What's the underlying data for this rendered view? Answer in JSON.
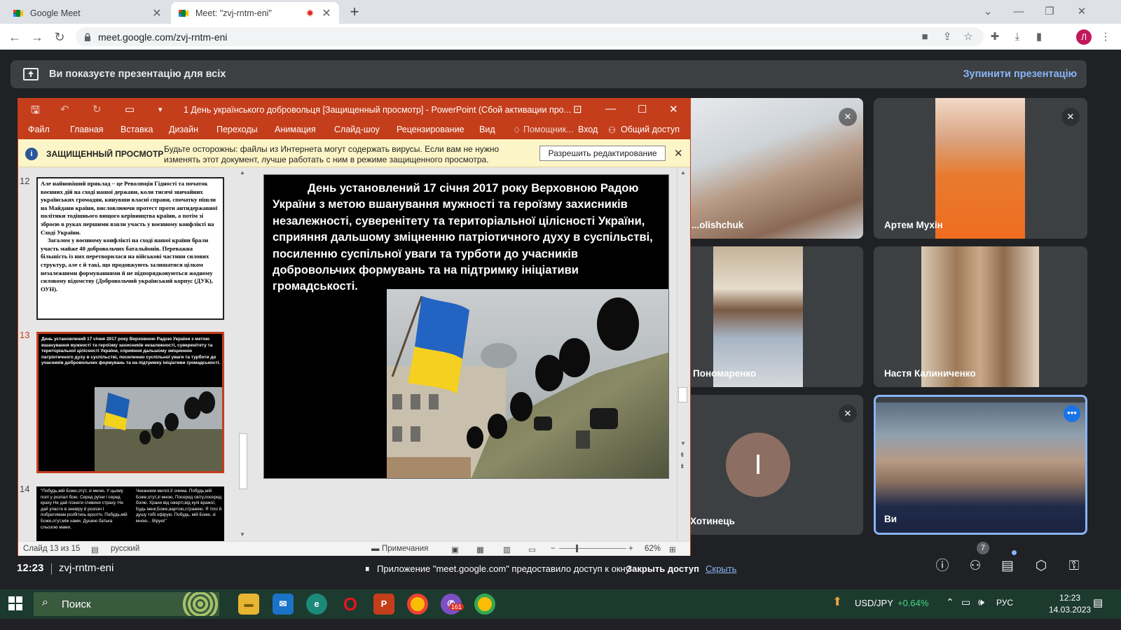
{
  "browser": {
    "tabs": [
      {
        "title": "Google Meet"
      },
      {
        "title": "Meet: \"zvj-rntm-eni\""
      }
    ],
    "url": "meet.google.com/zvj-rntm-eni",
    "profile_initial": "Л"
  },
  "meet": {
    "banner_text": "Ви показуєте презентацію для всіх",
    "stop_label": "Зупинити презентацію",
    "participants": [
      {
        "name": "...olishchuk",
        "muted": true
      },
      {
        "name": "Артем Мухін",
        "muted": true
      },
      {
        "name": "Пономаренко",
        "muted": false
      },
      {
        "name": "Настя Калиниченко",
        "muted": false
      },
      {
        "name": "Хотинець",
        "initial": "І",
        "muted": true
      },
      {
        "name": "Ви",
        "muted": false
      }
    ],
    "time": "12:23",
    "meeting_code": "zvj-rntm-eni",
    "participant_count": "7",
    "share_notice": "Приложение \"meet.google.com\" предоставило доступ к окну.",
    "close_access": "Закрыть доступ",
    "hide": "Скрыть"
  },
  "ppt": {
    "title": "1 День українського добровольця [Защищенный просмотр] - PowerPoint (Сбой активации про...",
    "menu": [
      "Файл",
      "Главная",
      "Вставка",
      "Дизайн",
      "Переходы",
      "Анимация",
      "Слайд-шоу",
      "Рецензирование",
      "Вид"
    ],
    "assistant": "Помощник...",
    "signin": "Вход",
    "share": "Общий доступ",
    "protected_label": "ЗАЩИЩЕННЫЙ ПРОСМОТР",
    "protected_msg": "Будьте осторожны: файлы из Интернета могут содержать вирусы. Если вам не нужно изменять этот документ, лучше работать с ним в режиме защищенного просмотра.",
    "enable_edit": "Разрешить редактирование",
    "thumbs": [
      {
        "num": "12",
        "text": "Але найновіший приклад – це Революція Гідності та початок воєнних дій на сході нашої держави, коли тисячі звичайних українських громадян, кинувши власні справи, спочатку пішли на Майдани країни, висловлюючи протест проти антидержавної політики тодішнього вищого керівництва країни, а потім зі зброєю в руках першими взяли участь у воєнному конфлікті на Сході України.",
        "text2": "Загалом у воєнному конфлікті на сході нашої країни брали участь майже 40 добровольчих батальйонів. Переважна більшість із них перетворилася на військові частини силових структур, але є й такі, що продовжують залишатися цілком незалежними формуваннями й не підпорядковуються жодному силовому відомству (Добровольчий український корпус (ДУК), ОУН)."
      },
      {
        "num": "13"
      },
      {
        "num": "14",
        "col1": "\"Побудь,мій Боже,отут, зі мною, У цьому полі у розпал бою. Серед руїни і серед краху Не дай пізнати гливини страху. Не дай упасти в зневіру й розпач І побратимам розбітись врозтіч. Побудь,мій Боже,отут,між нами. Душею батька сльозою мами,",
        "col2": "Чеканням милої,її очима. Побудь,мій Боже,отут,зі мною, Посеред світу,посеред болю. Храни від смерті,від кулі вражої, Будь мені,Боже,вартою,стражею. Я тіло й душу тобі офірую. Побудь, мій Боже, зі мною... Вірую!\""
      }
    ],
    "slide_text": "День установлений 17 січня 2017 року Верховною Радою України з метою вшанування мужності та героїзму захисників незалежності, суверенітету та територіальної цілісності України, сприяння дальшому зміцненню патріотичного духу в суспільстві, посиленню суспільної уваги та турботи до учасників добровольчих формувань та на підтримку ініціативи громадськості.",
    "status": {
      "slide": "Слайд 13 из 15",
      "lang": "русский",
      "notes": "Примечания",
      "zoom": "62%"
    }
  },
  "taskbar": {
    "search": "Поиск",
    "ticker": "USD/JPY",
    "ticker_change": "+0.64%",
    "lang": "РУС",
    "clock_time": "12:23",
    "clock_date": "14.03.2023",
    "badge": "161"
  }
}
